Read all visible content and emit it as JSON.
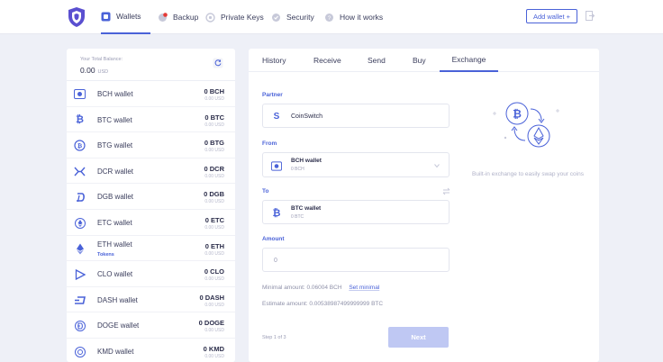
{
  "nav": {
    "items": [
      {
        "label": "Wallets",
        "icon": "wallet-icon",
        "active": true
      },
      {
        "label": "Backup",
        "icon": "backup-icon",
        "active": false
      },
      {
        "label": "Private Keys",
        "icon": "key-icon",
        "active": false
      },
      {
        "label": "Security",
        "icon": "security-icon",
        "active": false
      },
      {
        "label": "How it works",
        "icon": "help-icon",
        "active": false
      }
    ],
    "add_wallet_label": "Add wallet +"
  },
  "sidebar": {
    "balance_label": "Your Total Balance:",
    "balance_value": "0.00",
    "balance_unit": "USD",
    "wallets": [
      {
        "name": "BCH wallet",
        "amount": "0 BCH",
        "usd": "0.00 USD",
        "icon": "bch-icon"
      },
      {
        "name": "BTC wallet",
        "amount": "0 BTC",
        "usd": "0.00 USD",
        "icon": "btc-icon"
      },
      {
        "name": "BTG wallet",
        "amount": "0 BTG",
        "usd": "0.00 USD",
        "icon": "btg-icon"
      },
      {
        "name": "DCR wallet",
        "amount": "0 DCR",
        "usd": "0.00 USD",
        "icon": "dcr-icon"
      },
      {
        "name": "DGB wallet",
        "amount": "0 DGB",
        "usd": "0.00 USD",
        "icon": "dgb-icon"
      },
      {
        "name": "ETC wallet",
        "amount": "0 ETC",
        "usd": "0.00 USD",
        "icon": "etc-icon"
      },
      {
        "name": "ETH wallet",
        "amount": "0 ETH",
        "usd": "0.00 USD",
        "icon": "eth-icon",
        "tokens": "Tokens"
      },
      {
        "name": "CLO wallet",
        "amount": "0 CLO",
        "usd": "0.00 USD",
        "icon": "clo-icon"
      },
      {
        "name": "DASH wallet",
        "amount": "0 DASH",
        "usd": "0.00 USD",
        "icon": "dash-icon"
      },
      {
        "name": "DOGE wallet",
        "amount": "0 DOGE",
        "usd": "0.00 USD",
        "icon": "doge-icon"
      },
      {
        "name": "KMD wallet",
        "amount": "0 KMD",
        "usd": "0.00 USD",
        "icon": "kmd-icon"
      }
    ]
  },
  "tabs": [
    {
      "label": "History",
      "active": false
    },
    {
      "label": "Receive",
      "active": false
    },
    {
      "label": "Send",
      "active": false
    },
    {
      "label": "Buy",
      "active": false
    },
    {
      "label": "Exchange",
      "active": true
    }
  ],
  "exchange": {
    "partner_label": "Partner",
    "partner_value": "CoinSwitch",
    "from_label": "From",
    "from_wallet": "BCH wallet",
    "from_amount": "0 BCH",
    "to_label": "To",
    "to_wallet": "BTC wallet",
    "to_amount": "0 BTC",
    "amount_label": "Amount",
    "amount_placeholder": "0",
    "minimal_text": "Minimal amount: 0.06004 BCH",
    "set_minimal_label": "Set minimal",
    "estimate_text": "Estimate amount: 0.00538987499999999 BTC",
    "step_text": "Step 1 of 3",
    "next_label": "Next",
    "illustration_text": "Built-in exchange to easily swap your coins"
  },
  "colors": {
    "accent": "#4a62d8",
    "background": "#eef0f7",
    "button_disabled": "#bfc8f3"
  }
}
